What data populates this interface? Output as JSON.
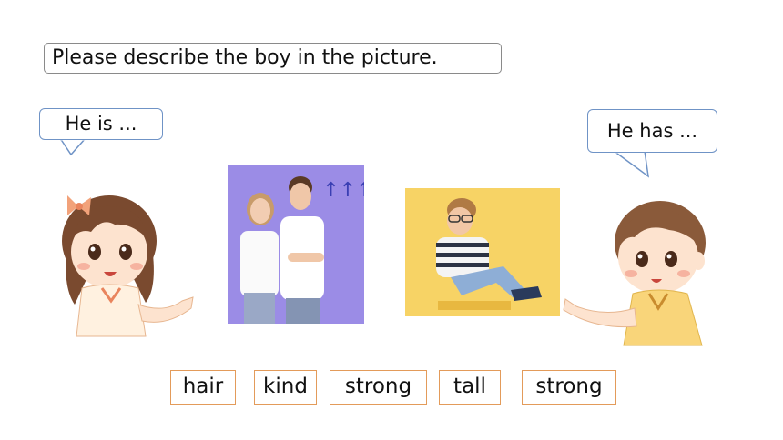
{
  "prompt": "Please describe the boy in the picture.",
  "speech_left": "He is ...",
  "speech_right": "He has ...",
  "photo_badge": "↑↑↑",
  "words": [
    "hair",
    "kind",
    "strong",
    "tall",
    "strong"
  ],
  "colors": {
    "bubble_border": "#6f93c6",
    "card_border": "#e39b5a",
    "photo1_bg": "#9b8ce6",
    "photo2_bg": "#f7d365"
  }
}
